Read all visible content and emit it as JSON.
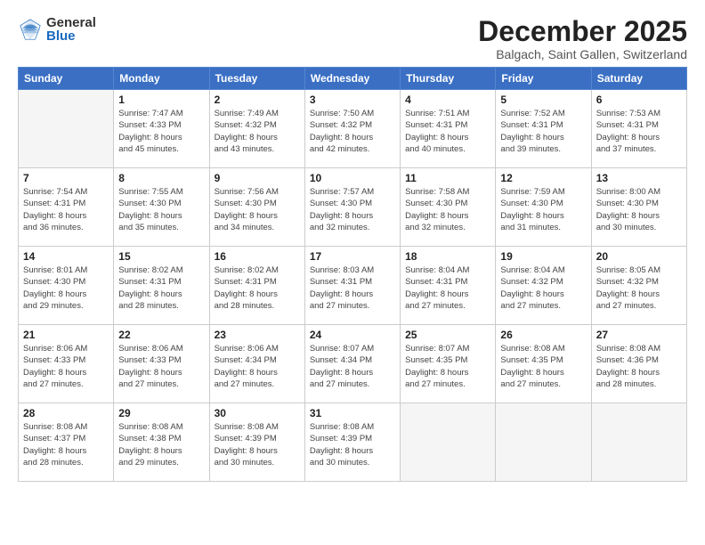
{
  "logo": {
    "general": "General",
    "blue": "Blue"
  },
  "title": "December 2025",
  "location": "Balgach, Saint Gallen, Switzerland",
  "weekdays": [
    "Sunday",
    "Monday",
    "Tuesday",
    "Wednesday",
    "Thursday",
    "Friday",
    "Saturday"
  ],
  "weeks": [
    [
      {
        "day": "",
        "info": ""
      },
      {
        "day": "1",
        "info": "Sunrise: 7:47 AM\nSunset: 4:33 PM\nDaylight: 8 hours\nand 45 minutes."
      },
      {
        "day": "2",
        "info": "Sunrise: 7:49 AM\nSunset: 4:32 PM\nDaylight: 8 hours\nand 43 minutes."
      },
      {
        "day": "3",
        "info": "Sunrise: 7:50 AM\nSunset: 4:32 PM\nDaylight: 8 hours\nand 42 minutes."
      },
      {
        "day": "4",
        "info": "Sunrise: 7:51 AM\nSunset: 4:31 PM\nDaylight: 8 hours\nand 40 minutes."
      },
      {
        "day": "5",
        "info": "Sunrise: 7:52 AM\nSunset: 4:31 PM\nDaylight: 8 hours\nand 39 minutes."
      },
      {
        "day": "6",
        "info": "Sunrise: 7:53 AM\nSunset: 4:31 PM\nDaylight: 8 hours\nand 37 minutes."
      }
    ],
    [
      {
        "day": "7",
        "info": "Sunrise: 7:54 AM\nSunset: 4:31 PM\nDaylight: 8 hours\nand 36 minutes."
      },
      {
        "day": "8",
        "info": "Sunrise: 7:55 AM\nSunset: 4:30 PM\nDaylight: 8 hours\nand 35 minutes."
      },
      {
        "day": "9",
        "info": "Sunrise: 7:56 AM\nSunset: 4:30 PM\nDaylight: 8 hours\nand 34 minutes."
      },
      {
        "day": "10",
        "info": "Sunrise: 7:57 AM\nSunset: 4:30 PM\nDaylight: 8 hours\nand 32 minutes."
      },
      {
        "day": "11",
        "info": "Sunrise: 7:58 AM\nSunset: 4:30 PM\nDaylight: 8 hours\nand 32 minutes."
      },
      {
        "day": "12",
        "info": "Sunrise: 7:59 AM\nSunset: 4:30 PM\nDaylight: 8 hours\nand 31 minutes."
      },
      {
        "day": "13",
        "info": "Sunrise: 8:00 AM\nSunset: 4:30 PM\nDaylight: 8 hours\nand 30 minutes."
      }
    ],
    [
      {
        "day": "14",
        "info": "Sunrise: 8:01 AM\nSunset: 4:30 PM\nDaylight: 8 hours\nand 29 minutes."
      },
      {
        "day": "15",
        "info": "Sunrise: 8:02 AM\nSunset: 4:31 PM\nDaylight: 8 hours\nand 28 minutes."
      },
      {
        "day": "16",
        "info": "Sunrise: 8:02 AM\nSunset: 4:31 PM\nDaylight: 8 hours\nand 28 minutes."
      },
      {
        "day": "17",
        "info": "Sunrise: 8:03 AM\nSunset: 4:31 PM\nDaylight: 8 hours\nand 27 minutes."
      },
      {
        "day": "18",
        "info": "Sunrise: 8:04 AM\nSunset: 4:31 PM\nDaylight: 8 hours\nand 27 minutes."
      },
      {
        "day": "19",
        "info": "Sunrise: 8:04 AM\nSunset: 4:32 PM\nDaylight: 8 hours\nand 27 minutes."
      },
      {
        "day": "20",
        "info": "Sunrise: 8:05 AM\nSunset: 4:32 PM\nDaylight: 8 hours\nand 27 minutes."
      }
    ],
    [
      {
        "day": "21",
        "info": "Sunrise: 8:06 AM\nSunset: 4:33 PM\nDaylight: 8 hours\nand 27 minutes."
      },
      {
        "day": "22",
        "info": "Sunrise: 8:06 AM\nSunset: 4:33 PM\nDaylight: 8 hours\nand 27 minutes."
      },
      {
        "day": "23",
        "info": "Sunrise: 8:06 AM\nSunset: 4:34 PM\nDaylight: 8 hours\nand 27 minutes."
      },
      {
        "day": "24",
        "info": "Sunrise: 8:07 AM\nSunset: 4:34 PM\nDaylight: 8 hours\nand 27 minutes."
      },
      {
        "day": "25",
        "info": "Sunrise: 8:07 AM\nSunset: 4:35 PM\nDaylight: 8 hours\nand 27 minutes."
      },
      {
        "day": "26",
        "info": "Sunrise: 8:08 AM\nSunset: 4:35 PM\nDaylight: 8 hours\nand 27 minutes."
      },
      {
        "day": "27",
        "info": "Sunrise: 8:08 AM\nSunset: 4:36 PM\nDaylight: 8 hours\nand 28 minutes."
      }
    ],
    [
      {
        "day": "28",
        "info": "Sunrise: 8:08 AM\nSunset: 4:37 PM\nDaylight: 8 hours\nand 28 minutes."
      },
      {
        "day": "29",
        "info": "Sunrise: 8:08 AM\nSunset: 4:38 PM\nDaylight: 8 hours\nand 29 minutes."
      },
      {
        "day": "30",
        "info": "Sunrise: 8:08 AM\nSunset: 4:39 PM\nDaylight: 8 hours\nand 30 minutes."
      },
      {
        "day": "31",
        "info": "Sunrise: 8:08 AM\nSunset: 4:39 PM\nDaylight: 8 hours\nand 30 minutes."
      },
      {
        "day": "",
        "info": ""
      },
      {
        "day": "",
        "info": ""
      },
      {
        "day": "",
        "info": ""
      }
    ]
  ]
}
